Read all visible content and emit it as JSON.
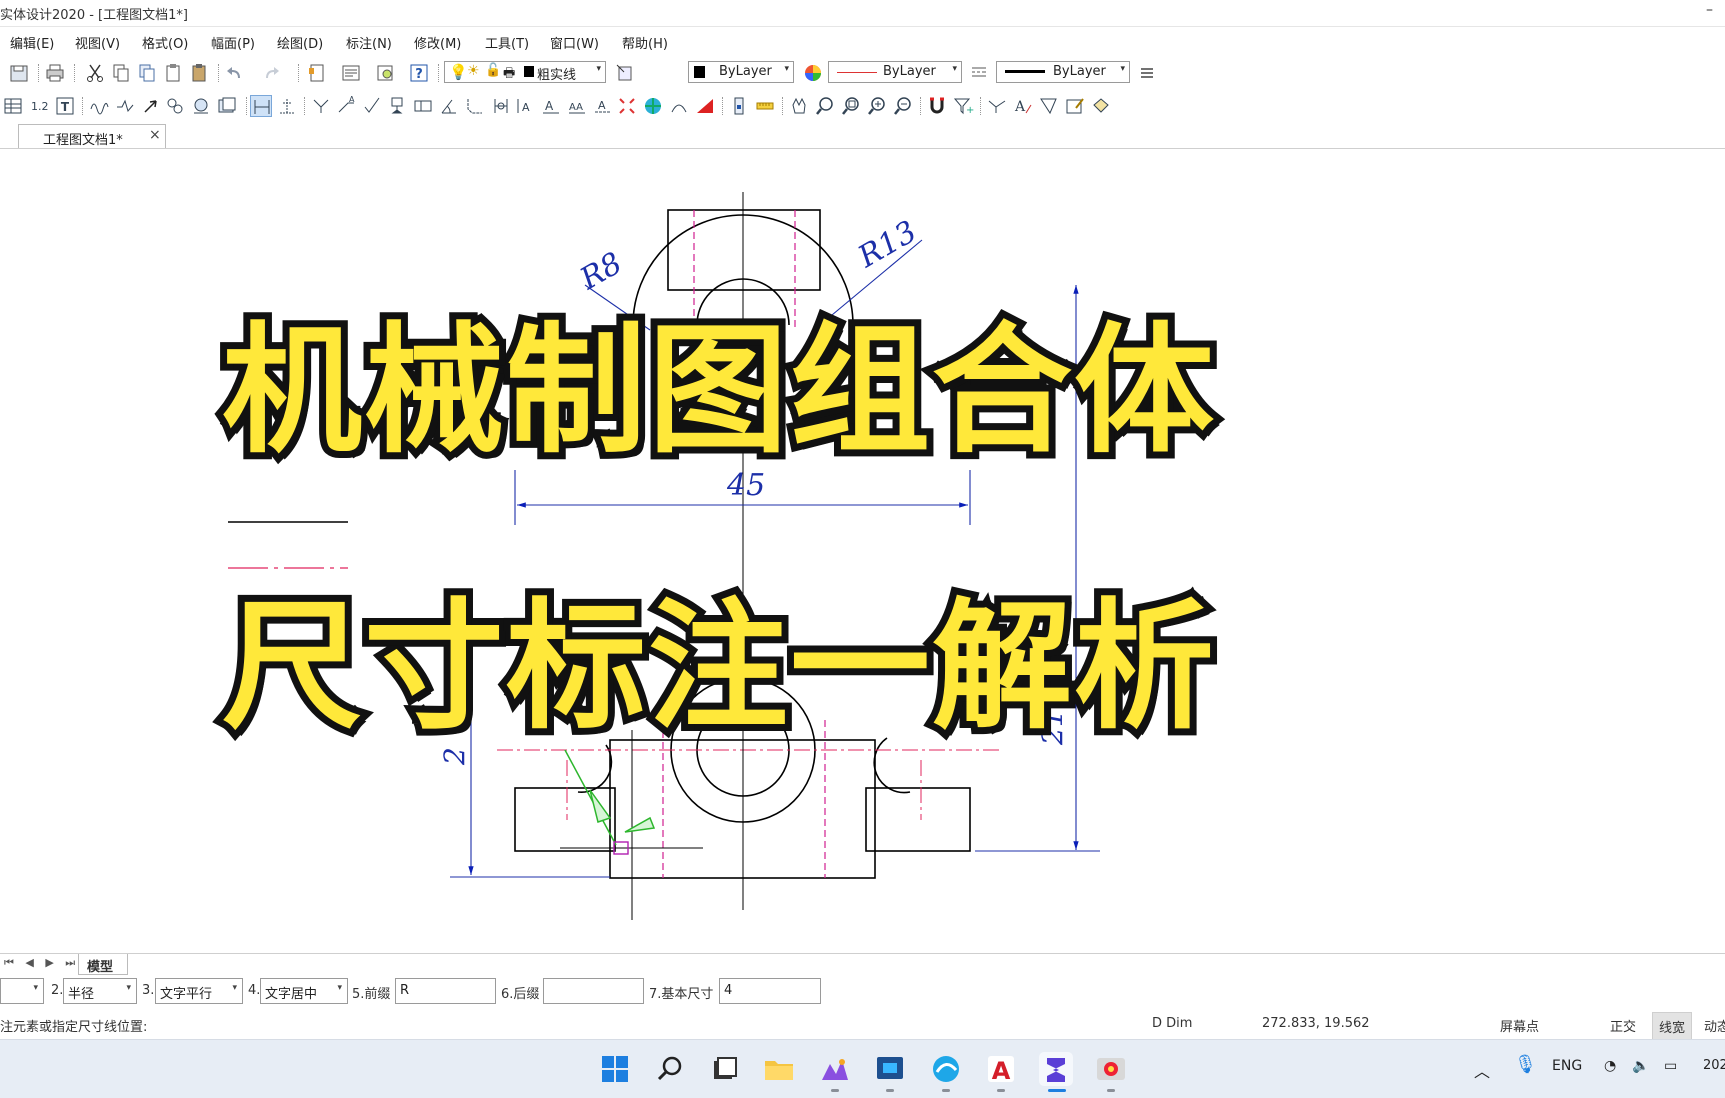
{
  "window": {
    "title": "实体设计2020 - [工程图文档1*]",
    "minimize": "–"
  },
  "menu": [
    "编辑(E)",
    "视图(V)",
    "格式(O)",
    "幅面(P)",
    "绘图(D)",
    "标注(N)",
    "修改(M)",
    "工具(T)",
    "窗口(W)",
    "帮助(H)"
  ],
  "toolbar1": {
    "linetype_label": "粗实线",
    "color_combo": "ByLayer",
    "linetype_combo": "ByLayer",
    "lineweight_combo": "ByLayer"
  },
  "tab": {
    "label": "工程图文档1*",
    "close": "×"
  },
  "drawing": {
    "dims": {
      "r8": "R8",
      "r13": "R13",
      "d45": "45",
      "left_vert": "2",
      "right_vert": "21"
    },
    "colors": {
      "line": "#000000",
      "center": "#e0245e",
      "hidden": "#d02090",
      "dim": "#1c2fa8",
      "arrow": "#0a1fb8",
      "guide": "#2db62d"
    }
  },
  "overlay": {
    "line1": "机械制图组合体",
    "line2": "尺寸标注一解析",
    "fill_color": "#ffe83a",
    "stroke_color": "#111111"
  },
  "layout_tabs": {
    "nav": "⏮ ◀ ▶ ⏭",
    "model": "模型"
  },
  "dim_bar": {
    "f2_label": "2.",
    "f2_value": "半径",
    "f3_label": "3.",
    "f3_value": "文字平行",
    "f4_label": "4.",
    "f4_value": "文字居中",
    "f5_label": "5.前缀",
    "f5_value": "R",
    "f6_label": "6.后缀",
    "f6_value": "",
    "f7_label": "7.基本尺寸",
    "f7_value": "4"
  },
  "status": {
    "prompt": "注元素或指定尺寸线位置:",
    "command": "D Dim",
    "coords": "272.833, 19.562",
    "snap": "屏幕点",
    "ortho": "正交",
    "lineweight": "线宽",
    "dynamic": "动态"
  },
  "taskbar": {
    "lang": "ENG",
    "clock": "202"
  }
}
